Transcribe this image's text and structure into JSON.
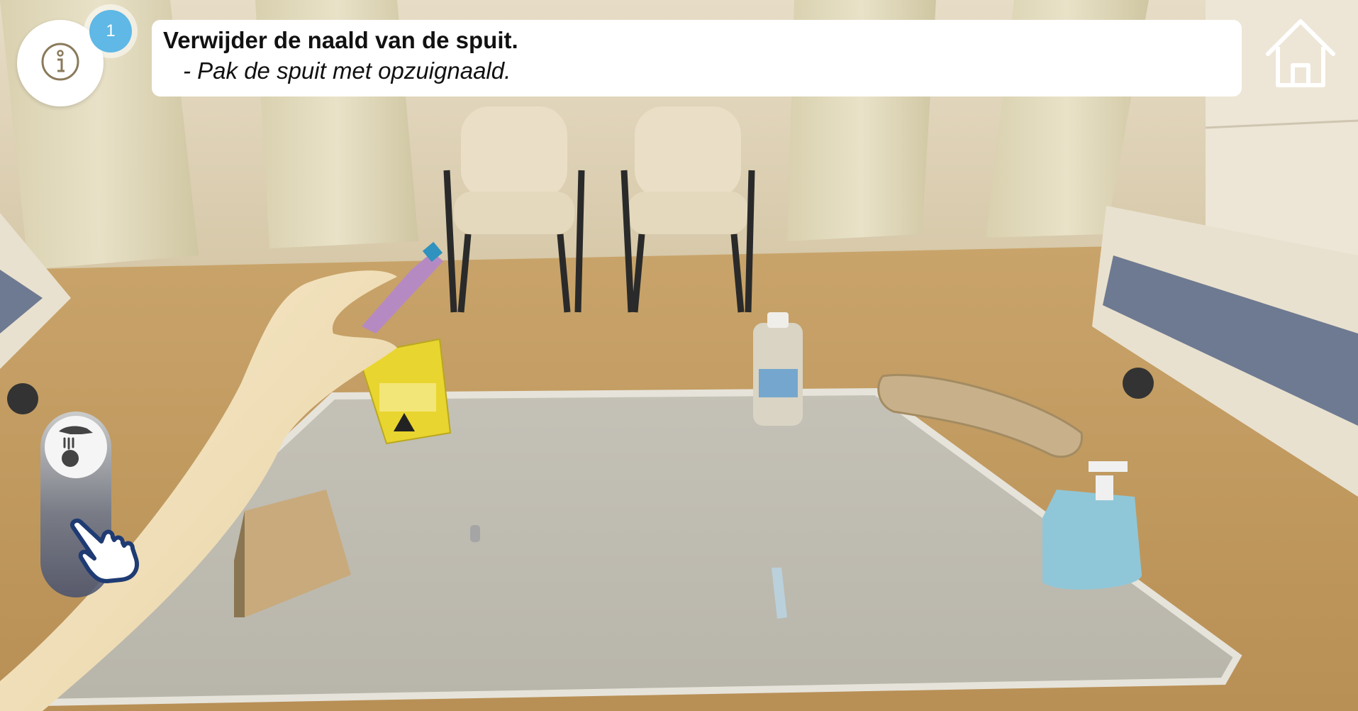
{
  "step": {
    "number": "1"
  },
  "instruction": {
    "title": "Verwijder de naald van de spuit.",
    "subtitle": "- Pak de spuit met opzuignaald."
  },
  "icons": {
    "info": "info-icon",
    "home": "home-icon",
    "grab": "grab-hand-icon",
    "pointer": "pointer-hand-icon"
  },
  "colors": {
    "badge": "#5fb8e6",
    "panel": "#ffffff",
    "icon_stroke": "#ffffff",
    "hand_icon": "#1f3b73"
  }
}
